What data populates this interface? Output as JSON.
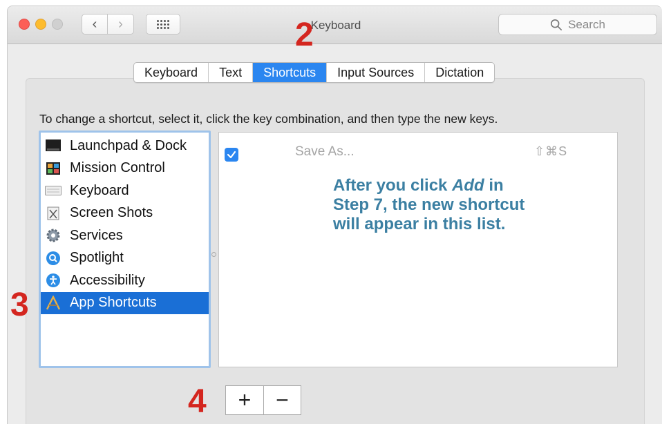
{
  "window": {
    "title": "Keyboard"
  },
  "toolbar": {
    "back_glyph": "‹",
    "forward_glyph": "›",
    "search_placeholder": "Search"
  },
  "tabs": [
    {
      "label": "Keyboard",
      "selected": false
    },
    {
      "label": "Text",
      "selected": false
    },
    {
      "label": "Shortcuts",
      "selected": true
    },
    {
      "label": "Input Sources",
      "selected": false
    },
    {
      "label": "Dictation",
      "selected": false
    }
  ],
  "instruction": "To change a shortcut, select it, click the key combination, and then type the new keys.",
  "categories": [
    {
      "label": "Launchpad & Dock",
      "icon": "launchpad-dock-icon"
    },
    {
      "label": "Mission Control",
      "icon": "mission-control-icon"
    },
    {
      "label": "Keyboard",
      "icon": "keyboard-icon"
    },
    {
      "label": "Screen Shots",
      "icon": "screenshot-icon"
    },
    {
      "label": "Services",
      "icon": "gear-icon"
    },
    {
      "label": "Spotlight",
      "icon": "spotlight-icon"
    },
    {
      "label": "Accessibility",
      "icon": "accessibility-icon"
    },
    {
      "label": "App Shortcuts",
      "icon": "app-shortcuts-icon",
      "selected": true
    }
  ],
  "shortcut_row": {
    "checked": true,
    "name": "Save As...",
    "keys": "⇧⌘S"
  },
  "annotation": {
    "line1_a": "After you click ",
    "line1_em": "Add",
    "line1_b": " in",
    "line2": "Step 7, the new shortcut",
    "line3": "will appear in this list."
  },
  "step_labels": {
    "two": "2",
    "three": "3",
    "four": "4"
  },
  "buttons": {
    "add": "+",
    "remove": "−"
  },
  "colors": {
    "accent": "#2b86f0",
    "selection": "#1a6fd6",
    "step_red": "#d4261f",
    "annotation": "#3b7fa2"
  }
}
